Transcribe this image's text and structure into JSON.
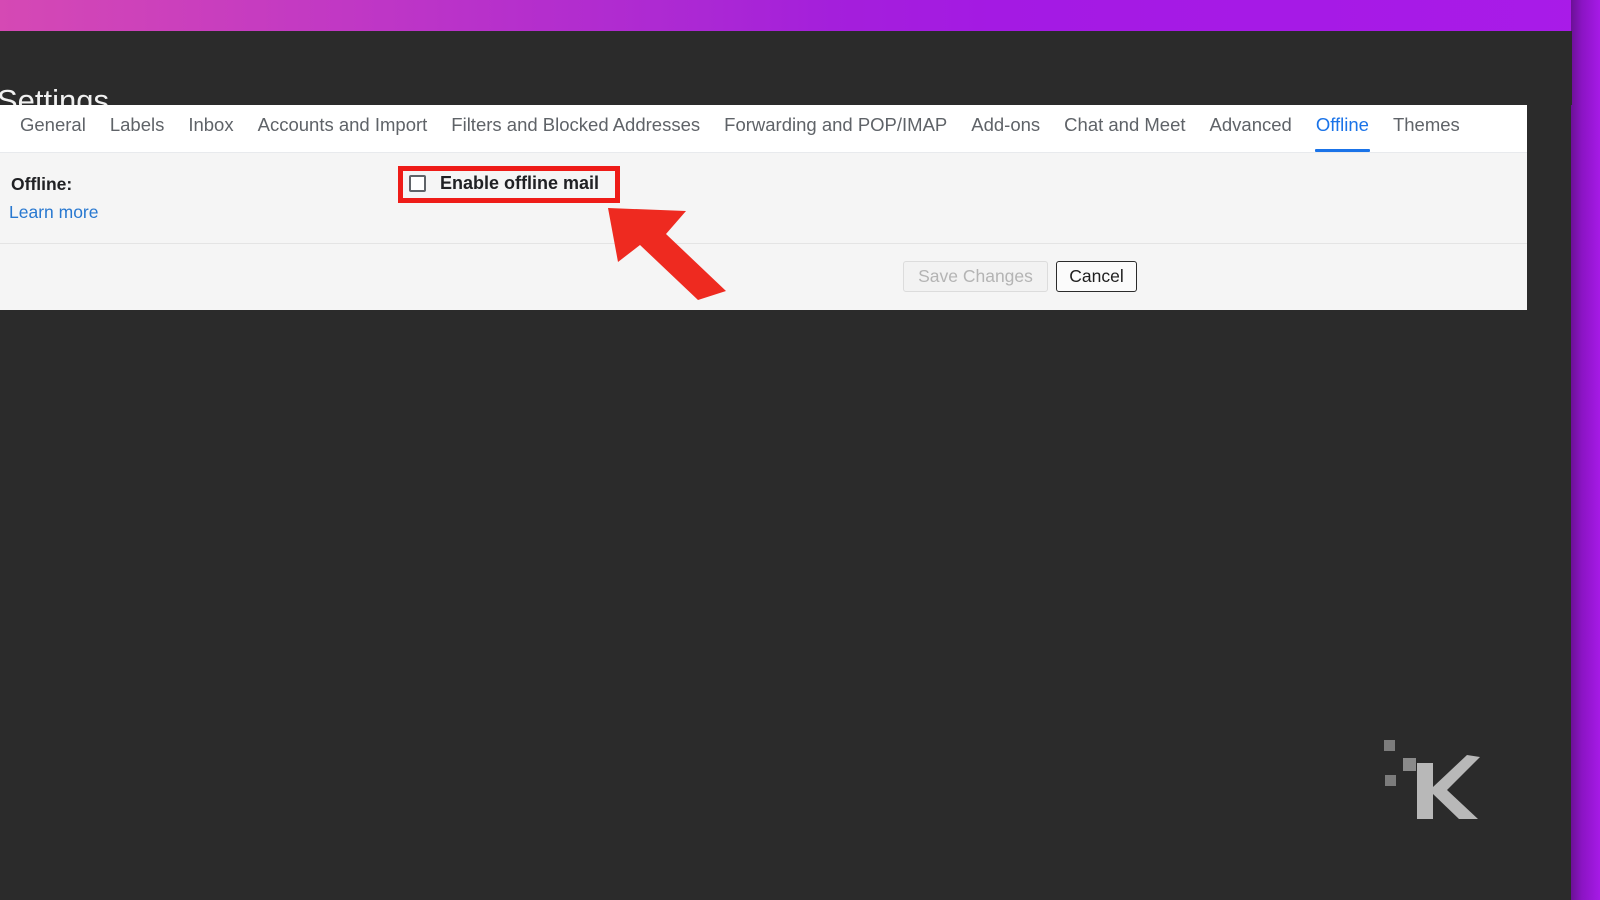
{
  "theme": {
    "accent_pink": "#d549b4",
    "accent_purple": "#a61ae6",
    "shell_dark": "#2b2b2b",
    "tab_active": "#1a73e8",
    "link_blue": "#2878d0",
    "highlight_red": "#ee1c18",
    "panel_gray": "#f5f5f5"
  },
  "header": {
    "title": "Settings"
  },
  "tabs": [
    {
      "label": "General",
      "active": false
    },
    {
      "label": "Labels",
      "active": false
    },
    {
      "label": "Inbox",
      "active": false
    },
    {
      "label": "Accounts and Import",
      "active": false
    },
    {
      "label": "Filters and Blocked Addresses",
      "active": false
    },
    {
      "label": "Forwarding and POP/IMAP",
      "active": false
    },
    {
      "label": "Add-ons",
      "active": false
    },
    {
      "label": "Chat and Meet",
      "active": false
    },
    {
      "label": "Advanced",
      "active": false
    },
    {
      "label": "Offline",
      "active": true
    },
    {
      "label": "Themes",
      "active": false
    }
  ],
  "offline_section": {
    "label": "Offline:",
    "learn_more_label": "Learn more",
    "checkbox_label": "Enable offline mail",
    "checkbox_checked": false
  },
  "actions": {
    "save_label": "Save Changes",
    "save_disabled": true,
    "cancel_label": "Cancel"
  },
  "annotations": {
    "highlight_target": "enable-offline-mail-checkbox",
    "arrow_points_to": "enable-offline-mail-checkbox"
  },
  "watermark": {
    "text": "K"
  }
}
